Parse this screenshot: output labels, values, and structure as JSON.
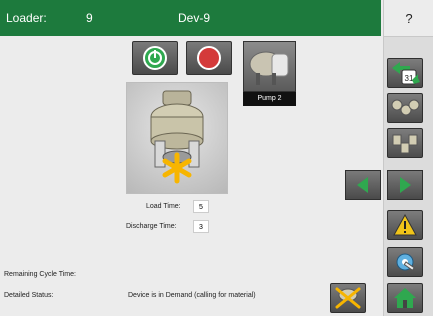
{
  "header": {
    "loader_label": "Loader:",
    "loader_number": "9",
    "device_name": "Dev-9",
    "help_label": "?"
  },
  "device": {
    "pump_label": "Pump 2"
  },
  "times": {
    "load_label": "Load Time:",
    "load_value": "5",
    "discharge_label": "Discharge Time:",
    "discharge_value": "3"
  },
  "status": {
    "remaining_label": "Remaining Cycle Time:",
    "detailed_label": "Detailed Status:",
    "detailed_value": "Device is in Demand (calling for material)"
  },
  "icons": {
    "calendar": "calendar-icon",
    "loaders_horizontal": "loaders-horizontal-icon",
    "loaders_bottom": "loaders-bottom-icon",
    "warning": "warning-icon",
    "settings": "settings-icon",
    "home": "home-icon",
    "device_status": "device-status-icon"
  },
  "calendar_day": "31",
  "colors": {
    "header_green": "#1d7a3d",
    "button_gray": "#5c5c5c",
    "start_green": "#2fa84f",
    "stop_red": "#d43a3a",
    "warning_yellow": "#f0c419"
  }
}
